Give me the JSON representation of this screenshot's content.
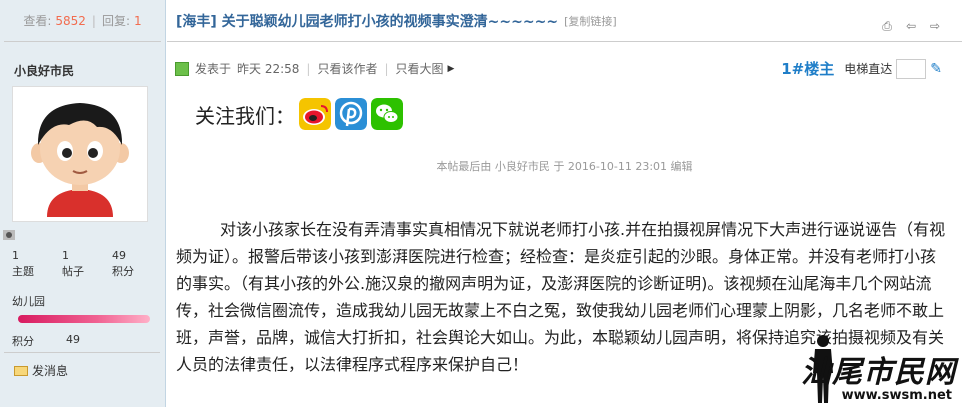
{
  "sidebar": {
    "view_label": "查看:",
    "view_count": "5852",
    "reply_label": "回复:",
    "reply_count": "1",
    "username": "小良好市民",
    "stats": [
      {
        "value": "1",
        "label": "主题"
      },
      {
        "value": "1",
        "label": "帖子"
      },
      {
        "value": "49",
        "label": "积分"
      }
    ],
    "group": "幼儿园",
    "level_progress": 1.0,
    "points_label": "积分",
    "points_value": "49",
    "send_message": "发消息"
  },
  "thread": {
    "title": "[海丰] 关于聪颖幼儿园老师打小孩的视频事实澄清~~~~~~",
    "copy_link": "[复制链接]"
  },
  "post": {
    "posted_label": "发表于",
    "posted_time": "昨天 22:58",
    "only_author": "只看该作者",
    "only_large_image": "只看大图",
    "floor": "1#楼主",
    "elevator": "电梯直达",
    "follow_label": "关注我们：",
    "edit_note": "本帖最后由 小良好市民 于 2016-10-11 23:01 编辑",
    "body": "对该小孩家长在没有弄清事实真相情况下就说老师打小孩.并在拍摄视屏情况下大声进行诬说诬告（有视频为证）。报警后带该小孩到澎湃医院进行检查；经检查：是炎症引起的沙眼。身体正常。并没有老师打小孩的事实。（有其小孩的外公.施汉泉的撤网声明为证，及澎湃医院的诊断证明)。该视频在汕尾海丰几个网站流传，社会微信圈流传，造成我幼儿园无故蒙上不白之冤，致使我幼儿园老师们心理蒙上阴影，几名老师不敢上班，声誉，品牌，诚信大打折扣，社会舆论大如山。为此，本聪颖幼儿园声明，将保持追究该拍摄视频及有关人员的法律责任，以法律程序式程序来保护自己！"
  },
  "watermark": {
    "title": "汕尾市民网",
    "url": "www.swsm.net"
  },
  "colors": {
    "sidebar_bg": "#e5edf2",
    "title_blue": "#336699",
    "floor_blue": "#1f7ec8",
    "count_orange": "#f26c4f"
  }
}
